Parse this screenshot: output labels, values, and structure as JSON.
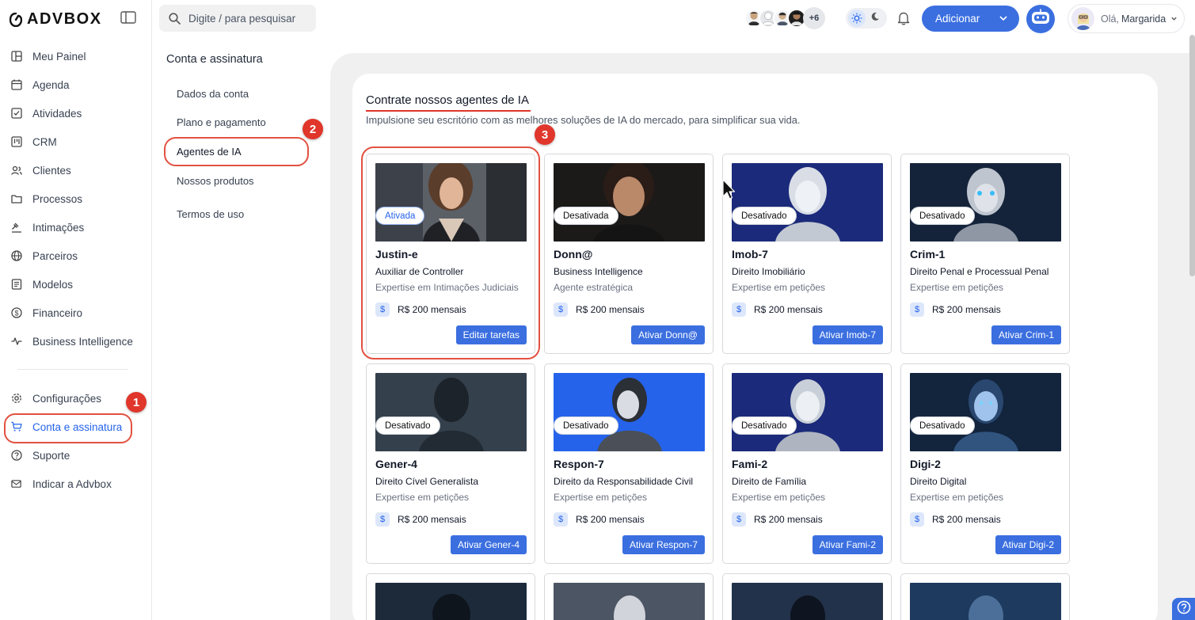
{
  "app": {
    "brand": "ADVBOX"
  },
  "search": {
    "placeholder": "Digite / para pesquisar"
  },
  "topbar": {
    "avatars_more": "+6",
    "add_label": "Adicionar",
    "user_greeting": "Olá,",
    "user_name": "Margarida"
  },
  "sidebar": {
    "items": [
      {
        "label": "Meu Painel",
        "icon": "dashboard-icon"
      },
      {
        "label": "Agenda",
        "icon": "calendar-icon"
      },
      {
        "label": "Atividades",
        "icon": "checkbox-icon"
      },
      {
        "label": "CRM",
        "icon": "kanban-icon"
      },
      {
        "label": "Clientes",
        "icon": "users-icon"
      },
      {
        "label": "Processos",
        "icon": "folder-icon"
      },
      {
        "label": "Intimações",
        "icon": "gavel-icon"
      },
      {
        "label": "Parceiros",
        "icon": "globe-icon"
      },
      {
        "label": "Modelos",
        "icon": "document-icon"
      },
      {
        "label": "Financeiro",
        "icon": "dollar-icon"
      },
      {
        "label": "Business Intelligence",
        "icon": "activity-icon"
      }
    ],
    "bottom_items": [
      {
        "label": "Configurações",
        "icon": "gear-icon"
      },
      {
        "label": "Conta e assinatura",
        "icon": "cart-icon",
        "active": true
      },
      {
        "label": "Suporte",
        "icon": "help-icon"
      },
      {
        "label": "Indicar a Advbox",
        "icon": "mail-icon"
      }
    ]
  },
  "submenu": {
    "title": "Conta e assinatura",
    "items": [
      "Dados da conta",
      "Plano e pagamento",
      "Agentes de IA",
      "Nossos produtos",
      "Termos de uso"
    ]
  },
  "markers": [
    "1",
    "2",
    "3"
  ],
  "page": {
    "title": "Contrate nossos agentes de IA",
    "subtitle": "Impulsione seu escritório com as melhores soluções de IA do mercado, para simplificar sua vida."
  },
  "agents": [
    {
      "name": "Justin-e",
      "status": "Ativada",
      "role": "Auxiliar de Controller",
      "expertise": "Expertise em Intimações Judiciais",
      "price": "R$ 200 mensais",
      "button": "Editar tarefas"
    },
    {
      "name": "Donn@",
      "status": "Desativada",
      "role": "Business Intelligence",
      "expertise": "Agente estratégica",
      "price": "R$ 200 mensais",
      "button": "Ativar Donn@"
    },
    {
      "name": "Imob-7",
      "status": "Desativado",
      "role": "Direito Imobiliário",
      "expertise": "Expertise em petições",
      "price": "R$ 200 mensais",
      "button": "Ativar Imob-7"
    },
    {
      "name": "Crim-1",
      "status": "Desativado",
      "role": "Direito Penal e Processual Penal",
      "expertise": "Expertise em petições",
      "price": "R$ 200 mensais",
      "button": "Ativar Crim-1"
    },
    {
      "name": "Gener-4",
      "status": "Desativado",
      "role": "Direito Cível Generalista",
      "expertise": "Expertise em petições",
      "price": "R$ 200 mensais",
      "button": "Ativar Gener-4"
    },
    {
      "name": "Respon-7",
      "status": "Desativado",
      "role": "Direito da Responsabilidade Civil",
      "expertise": "Expertise em petições",
      "price": "R$ 200 mensais",
      "button": "Ativar Respon-7"
    },
    {
      "name": "Fami-2",
      "status": "Desativado",
      "role": "Direito de Família",
      "expertise": "Expertise em petições",
      "price": "R$ 200 mensais",
      "button": "Ativar Fami-2"
    },
    {
      "name": "Digi-2",
      "status": "Desativado",
      "role": "Direito Digital",
      "expertise": "Expertise em petições",
      "price": "R$ 200 mensais",
      "button": "Ativar Digi-2"
    }
  ],
  "colors": {
    "accent": "#3b6fe0",
    "marker": "#e0362b",
    "panel_bg": "#f0f0f1"
  }
}
